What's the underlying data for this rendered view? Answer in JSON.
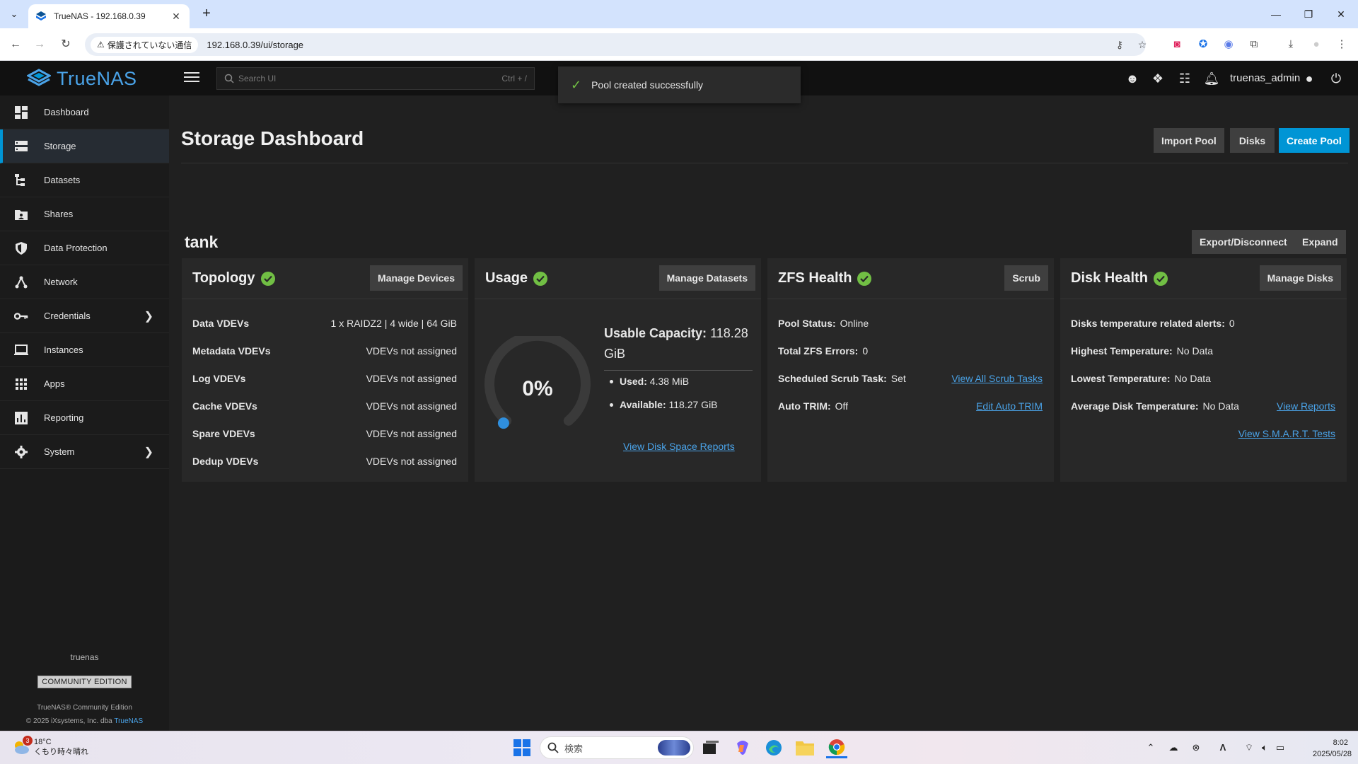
{
  "browser": {
    "tab_title": "TrueNAS - 192.168.0.39",
    "security_chip": "保護されていない通信",
    "url": "192.168.0.39/ui/storage"
  },
  "header": {
    "logo_text": "TrueNAS",
    "search_placeholder": "Search UI",
    "search_shortcut": "Ctrl + /",
    "username": "truenas_admin"
  },
  "toast": {
    "message": "Pool created successfully"
  },
  "sidebar": {
    "items": [
      {
        "label": "Dashboard",
        "icon": "dashboard-icon"
      },
      {
        "label": "Storage",
        "icon": "storage-icon",
        "active": true
      },
      {
        "label": "Datasets",
        "icon": "datasets-icon"
      },
      {
        "label": "Shares",
        "icon": "shares-icon"
      },
      {
        "label": "Data Protection",
        "icon": "shield-icon"
      },
      {
        "label": "Network",
        "icon": "network-icon"
      },
      {
        "label": "Credentials",
        "icon": "key-icon",
        "chevron": true
      },
      {
        "label": "Instances",
        "icon": "laptop-icon"
      },
      {
        "label": "Apps",
        "icon": "apps-grid-icon"
      },
      {
        "label": "Reporting",
        "icon": "bar-chart-icon"
      },
      {
        "label": "System",
        "icon": "gear-icon",
        "chevron": true
      }
    ],
    "hostname": "truenas",
    "edition_badge": "COMMUNITY EDITION",
    "footer_line1": "TrueNAS® Community Edition",
    "footer_line2_prefix": "© 2025 iXsystems, Inc. dba",
    "footer_line2_link": "TrueNAS"
  },
  "main": {
    "title": "Storage Dashboard",
    "import_pool": "Import Pool",
    "disks": "Disks",
    "create_pool": "Create Pool",
    "pool_name": "tank",
    "export_disconnect": "Export/Disconnect",
    "expand": "Expand"
  },
  "topology": {
    "title": "Topology",
    "button": "Manage Devices",
    "rows": [
      {
        "label": "Data VDEVs",
        "value": "1 x RAIDZ2 | 4 wide | 64 GiB"
      },
      {
        "label": "Metadata VDEVs",
        "value": "VDEVs not assigned"
      },
      {
        "label": "Log VDEVs",
        "value": "VDEVs not assigned"
      },
      {
        "label": "Cache VDEVs",
        "value": "VDEVs not assigned"
      },
      {
        "label": "Spare VDEVs",
        "value": "VDEVs not assigned"
      },
      {
        "label": "Dedup VDEVs",
        "value": "VDEVs not assigned"
      }
    ]
  },
  "usage": {
    "title": "Usage",
    "button": "Manage Datasets",
    "percent_label": "0%",
    "used_fraction": 0,
    "capacity_label": "Usable Capacity:",
    "capacity_value": "118.28 GiB",
    "used_label": "Used:",
    "used_value": "4.38 MiB",
    "available_label": "Available:",
    "available_value": "118.27 GiB",
    "report_link": "View Disk Space Reports"
  },
  "zfs_health": {
    "title": "ZFS Health",
    "button": "Scrub",
    "pool_status_label": "Pool Status:",
    "pool_status_value": "Online",
    "errors_label": "Total ZFS Errors:",
    "errors_value": "0",
    "scrub_label": "Scheduled Scrub Task:",
    "scrub_value": "Set",
    "scrub_link": "View All Scrub Tasks",
    "trim_label": "Auto TRIM:",
    "trim_value": "Off",
    "trim_link": "Edit Auto TRIM"
  },
  "disk_health": {
    "title": "Disk Health",
    "button": "Manage Disks",
    "temp_alerts_label": "Disks temperature related alerts:",
    "temp_alerts_value": "0",
    "highest_label": "Highest Temperature:",
    "highest_value": "No Data",
    "lowest_label": "Lowest Temperature:",
    "lowest_value": "No Data",
    "average_label": "Average Disk Temperature:",
    "average_value": "No Data",
    "reports_link": "View Reports",
    "smart_link": "View S.M.A.R.T. Tests"
  },
  "taskbar": {
    "weather_temp": "18°C",
    "weather_desc": "くもり時々晴れ",
    "weather_badge": "3",
    "search_label": "検索",
    "time": "8:02",
    "date": "2025/05/28"
  },
  "colors": {
    "accent": "#0095d5",
    "ok": "#71bf44",
    "link": "#4aa3e8"
  }
}
